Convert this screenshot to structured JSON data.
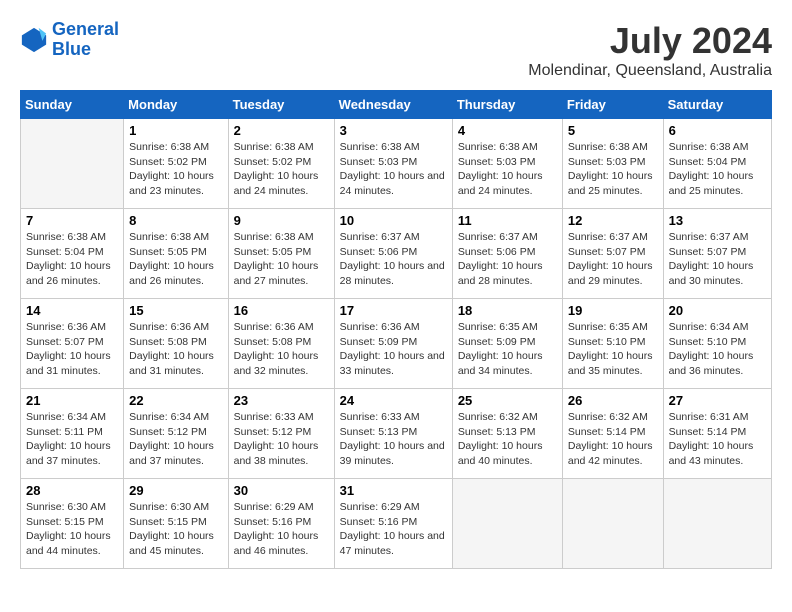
{
  "header": {
    "logo_line1": "General",
    "logo_line2": "Blue",
    "title": "July 2024",
    "subtitle": "Molendinar, Queensland, Australia"
  },
  "calendar": {
    "days_of_week": [
      "Sunday",
      "Monday",
      "Tuesday",
      "Wednesday",
      "Thursday",
      "Friday",
      "Saturday"
    ],
    "weeks": [
      [
        {
          "num": "",
          "empty": true
        },
        {
          "num": "1",
          "sunrise": "6:38 AM",
          "sunset": "5:02 PM",
          "daylight": "10 hours and 23 minutes."
        },
        {
          "num": "2",
          "sunrise": "6:38 AM",
          "sunset": "5:02 PM",
          "daylight": "10 hours and 24 minutes."
        },
        {
          "num": "3",
          "sunrise": "6:38 AM",
          "sunset": "5:03 PM",
          "daylight": "10 hours and 24 minutes."
        },
        {
          "num": "4",
          "sunrise": "6:38 AM",
          "sunset": "5:03 PM",
          "daylight": "10 hours and 24 minutes."
        },
        {
          "num": "5",
          "sunrise": "6:38 AM",
          "sunset": "5:03 PM",
          "daylight": "10 hours and 25 minutes."
        },
        {
          "num": "6",
          "sunrise": "6:38 AM",
          "sunset": "5:04 PM",
          "daylight": "10 hours and 25 minutes."
        }
      ],
      [
        {
          "num": "7",
          "sunrise": "6:38 AM",
          "sunset": "5:04 PM",
          "daylight": "10 hours and 26 minutes."
        },
        {
          "num": "8",
          "sunrise": "6:38 AM",
          "sunset": "5:05 PM",
          "daylight": "10 hours and 26 minutes."
        },
        {
          "num": "9",
          "sunrise": "6:38 AM",
          "sunset": "5:05 PM",
          "daylight": "10 hours and 27 minutes."
        },
        {
          "num": "10",
          "sunrise": "6:37 AM",
          "sunset": "5:06 PM",
          "daylight": "10 hours and 28 minutes."
        },
        {
          "num": "11",
          "sunrise": "6:37 AM",
          "sunset": "5:06 PM",
          "daylight": "10 hours and 28 minutes."
        },
        {
          "num": "12",
          "sunrise": "6:37 AM",
          "sunset": "5:07 PM",
          "daylight": "10 hours and 29 minutes."
        },
        {
          "num": "13",
          "sunrise": "6:37 AM",
          "sunset": "5:07 PM",
          "daylight": "10 hours and 30 minutes."
        }
      ],
      [
        {
          "num": "14",
          "sunrise": "6:36 AM",
          "sunset": "5:07 PM",
          "daylight": "10 hours and 31 minutes."
        },
        {
          "num": "15",
          "sunrise": "6:36 AM",
          "sunset": "5:08 PM",
          "daylight": "10 hours and 31 minutes."
        },
        {
          "num": "16",
          "sunrise": "6:36 AM",
          "sunset": "5:08 PM",
          "daylight": "10 hours and 32 minutes."
        },
        {
          "num": "17",
          "sunrise": "6:36 AM",
          "sunset": "5:09 PM",
          "daylight": "10 hours and 33 minutes."
        },
        {
          "num": "18",
          "sunrise": "6:35 AM",
          "sunset": "5:09 PM",
          "daylight": "10 hours and 34 minutes."
        },
        {
          "num": "19",
          "sunrise": "6:35 AM",
          "sunset": "5:10 PM",
          "daylight": "10 hours and 35 minutes."
        },
        {
          "num": "20",
          "sunrise": "6:34 AM",
          "sunset": "5:10 PM",
          "daylight": "10 hours and 36 minutes."
        }
      ],
      [
        {
          "num": "21",
          "sunrise": "6:34 AM",
          "sunset": "5:11 PM",
          "daylight": "10 hours and 37 minutes."
        },
        {
          "num": "22",
          "sunrise": "6:34 AM",
          "sunset": "5:12 PM",
          "daylight": "10 hours and 37 minutes."
        },
        {
          "num": "23",
          "sunrise": "6:33 AM",
          "sunset": "5:12 PM",
          "daylight": "10 hours and 38 minutes."
        },
        {
          "num": "24",
          "sunrise": "6:33 AM",
          "sunset": "5:13 PM",
          "daylight": "10 hours and 39 minutes."
        },
        {
          "num": "25",
          "sunrise": "6:32 AM",
          "sunset": "5:13 PM",
          "daylight": "10 hours and 40 minutes."
        },
        {
          "num": "26",
          "sunrise": "6:32 AM",
          "sunset": "5:14 PM",
          "daylight": "10 hours and 42 minutes."
        },
        {
          "num": "27",
          "sunrise": "6:31 AM",
          "sunset": "5:14 PM",
          "daylight": "10 hours and 43 minutes."
        }
      ],
      [
        {
          "num": "28",
          "sunrise": "6:30 AM",
          "sunset": "5:15 PM",
          "daylight": "10 hours and 44 minutes."
        },
        {
          "num": "29",
          "sunrise": "6:30 AM",
          "sunset": "5:15 PM",
          "daylight": "10 hours and 45 minutes."
        },
        {
          "num": "30",
          "sunrise": "6:29 AM",
          "sunset": "5:16 PM",
          "daylight": "10 hours and 46 minutes."
        },
        {
          "num": "31",
          "sunrise": "6:29 AM",
          "sunset": "5:16 PM",
          "daylight": "10 hours and 47 minutes."
        },
        {
          "num": "",
          "empty": true
        },
        {
          "num": "",
          "empty": true
        },
        {
          "num": "",
          "empty": true
        }
      ]
    ]
  }
}
